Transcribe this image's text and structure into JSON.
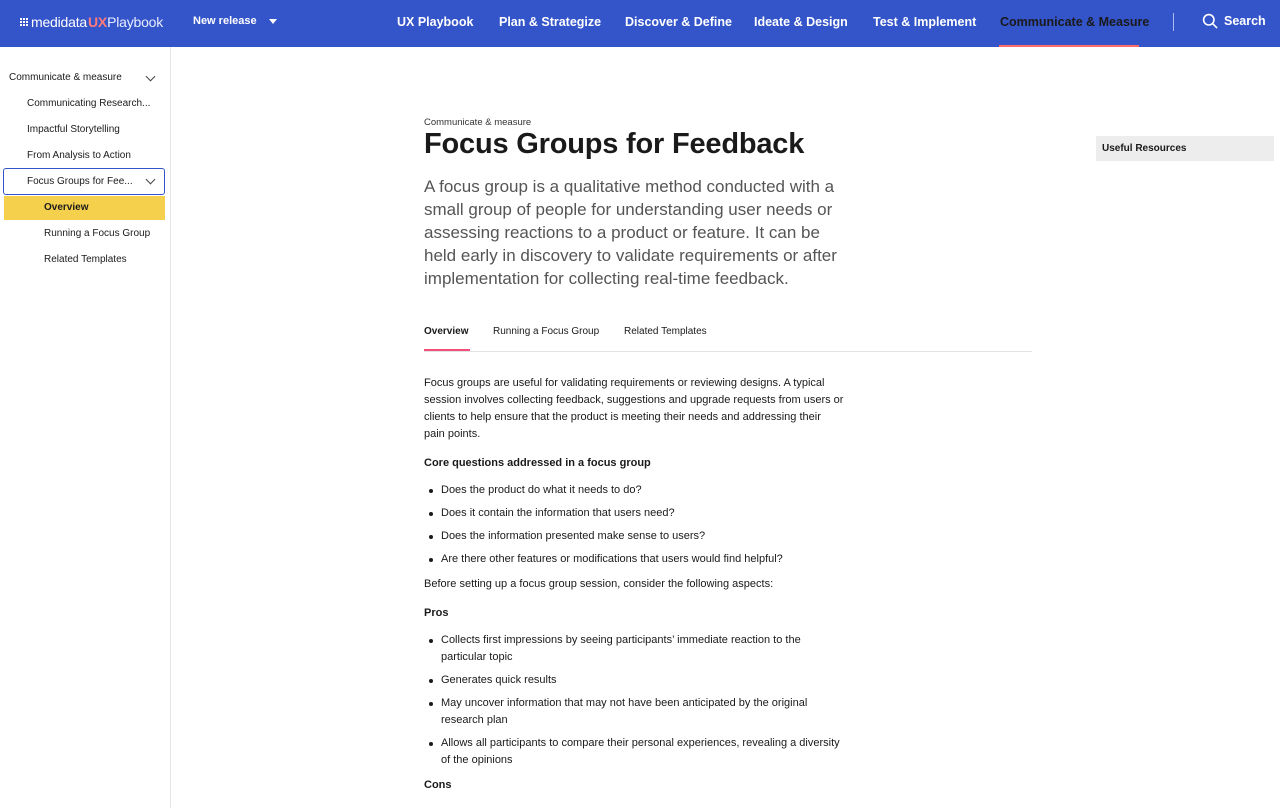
{
  "header": {
    "logo": {
      "brand": "medidata",
      "ux": "UX",
      "product": "Playbook"
    },
    "release_label": "New release",
    "nav": [
      {
        "label": "UX Playbook"
      },
      {
        "label": "Plan & Strategize"
      },
      {
        "label": "Discover & Define"
      },
      {
        "label": "Ideate & Design"
      },
      {
        "label": "Test & Implement"
      },
      {
        "label": "Communicate & Measure",
        "active": true
      }
    ],
    "search_label": "Search"
  },
  "sidebar": {
    "section_label": "Communicate & measure",
    "items": [
      {
        "label": "Communicating Research..."
      },
      {
        "label": "Impactful Storytelling"
      },
      {
        "label": "From Analysis to Action"
      },
      {
        "label": "Focus Groups for Fee...",
        "selected": true
      }
    ],
    "subitems": [
      {
        "label": "Overview",
        "active": true
      },
      {
        "label": "Running a Focus Group"
      },
      {
        "label": "Related Templates"
      }
    ]
  },
  "main": {
    "breadcrumb": "Communicate & measure",
    "title": "Focus Groups for Feedback",
    "lead": "A focus group is a qualitative method conducted with a small group of people for understanding user needs or assessing reactions to a product or feature. It can be held early in discovery to validate requirements or after implementation for collecting real-time feedback.",
    "tabs": [
      {
        "label": "Overview",
        "active": true
      },
      {
        "label": "Running a Focus Group"
      },
      {
        "label": "Related Templates"
      }
    ],
    "intro": "Focus groups are useful for validating requirements or reviewing designs. A typical session involves collecting feedback, suggestions and upgrade requests from users or clients to help ensure that the product is meeting their needs and addressing their pain points.",
    "questions_heading": "Core questions addressed in a focus group",
    "questions": [
      "Does the product do what it needs to do?",
      "Does it contain the information that users need?",
      "Does the information presented make sense to users?",
      "Are there other features or modifications that users would find helpful?"
    ],
    "consider_text": "Before setting up a focus group session, consider the following aspects:",
    "pros_heading": "Pros",
    "pros": [
      "Collects first impressions by seeing participants’ immediate reaction to the particular topic",
      "Generates quick results",
      "May uncover information that may not have been anticipated by the original research plan",
      "Allows all participants to compare their personal experiences, revealing a diversity of the opinions"
    ],
    "cons_heading": "Cons"
  },
  "aside": {
    "resources_label": "Useful Resources"
  },
  "colors": {
    "header_bg": "#3454c9",
    "active_highlight": "#f5d04c",
    "tab_accent": "#ef4f78",
    "nav_accent": "#ff6b6b"
  }
}
